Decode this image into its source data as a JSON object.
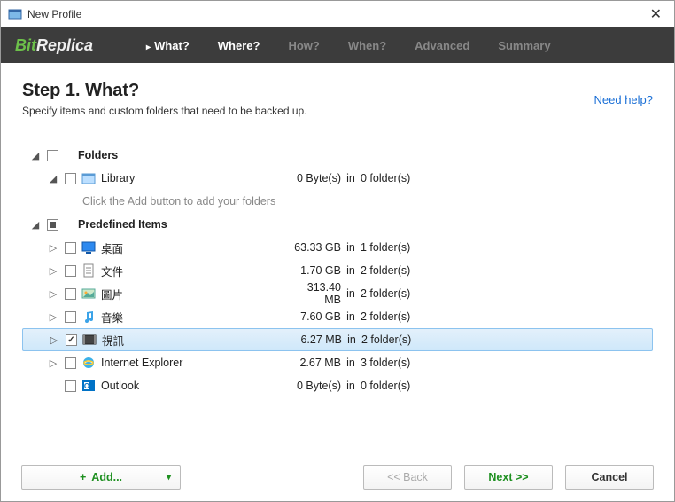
{
  "window": {
    "title": "New Profile"
  },
  "logo": {
    "part1": "Bit",
    "part2": "Replica"
  },
  "nav": {
    "tabs": [
      {
        "label": "What?",
        "active": true,
        "marker": true
      },
      {
        "label": "Where?",
        "active": true
      },
      {
        "label": "How?"
      },
      {
        "label": "When?"
      },
      {
        "label": "Advanced"
      },
      {
        "label": "Summary"
      }
    ]
  },
  "step": {
    "title": "Step 1. What?",
    "desc": "Specify items and custom folders that need to be backed up.",
    "help": "Need help?"
  },
  "tree": {
    "folders_header": "Folders",
    "library_label": "Library",
    "library_size": "0 Byte(s)",
    "library_in": "in",
    "library_folders": "0 folder(s)",
    "hint": "Click the Add button to add your folders",
    "predefined_header": "Predefined Items",
    "items": [
      {
        "label": "桌面",
        "size": "63.33 GB",
        "in": "in",
        "folders": "1 folder(s)",
        "icon": "desktop",
        "checked": false
      },
      {
        "label": "文件",
        "size": "1.70 GB",
        "in": "in",
        "folders": "2 folder(s)",
        "icon": "documents",
        "checked": false
      },
      {
        "label": "圖片",
        "size": "313.40 MB",
        "in": "in",
        "folders": "2 folder(s)",
        "icon": "pictures",
        "checked": false
      },
      {
        "label": "音樂",
        "size": "7.60 GB",
        "in": "in",
        "folders": "2 folder(s)",
        "icon": "music",
        "checked": false
      },
      {
        "label": "視訊",
        "size": "6.27 MB",
        "in": "in",
        "folders": "2 folder(s)",
        "icon": "videos",
        "checked": true,
        "selected": true
      },
      {
        "label": "Internet Explorer",
        "size": "2.67 MB",
        "in": "in",
        "folders": "3 folder(s)",
        "icon": "ie",
        "checked": false
      },
      {
        "label": "Outlook",
        "size": "0 Byte(s)",
        "in": "in",
        "folders": "0 folder(s)",
        "icon": "outlook",
        "checked": false,
        "no_expander": true
      }
    ]
  },
  "buttons": {
    "add": "Add...",
    "back": "<< Back",
    "next": "Next >>",
    "cancel": "Cancel"
  }
}
